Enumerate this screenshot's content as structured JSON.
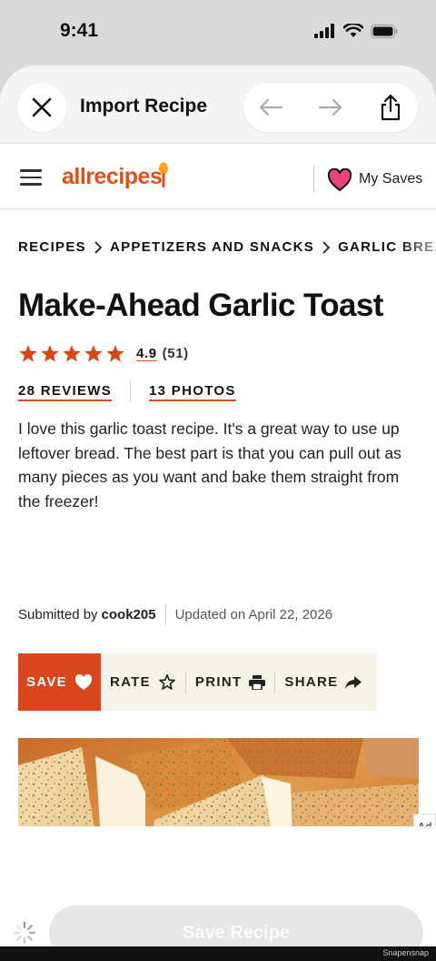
{
  "status_bar": {
    "time": "9:41"
  },
  "import_header": {
    "title": "Import Recipe"
  },
  "site": {
    "logo": "allrecipes",
    "my_saves": "My Saves"
  },
  "breadcrumb": [
    "RECIPES",
    "APPETIZERS AND SNACKS",
    "GARLIC BREA"
  ],
  "recipe": {
    "title": "Make-Ahead Garlic Toast",
    "rating": "4.9",
    "rating_count": "(51)",
    "stars": 5,
    "reviews": "28 REVIEWS",
    "photos": "13 PHOTOS",
    "description": "I love this garlic toast recipe. It's a great way to use up leftover bread. The best part is that you can pull out as many pieces as you want and bake them straight from the freezer!",
    "submitted_prefix": "Submitted by",
    "author": "cook205",
    "updated": "Updated on April 22, 2026"
  },
  "actions": {
    "save": "SAVE",
    "rate": "RATE",
    "print": "PRINT",
    "share": "SHARE"
  },
  "ad_label": "Ad",
  "bottom": {
    "save_recipe": "Save Recipe"
  },
  "watermark": "Snapensnap",
  "colors": {
    "brand": "#e04f1a",
    "save_bg": "#d9461b",
    "star": "#d9461b"
  }
}
